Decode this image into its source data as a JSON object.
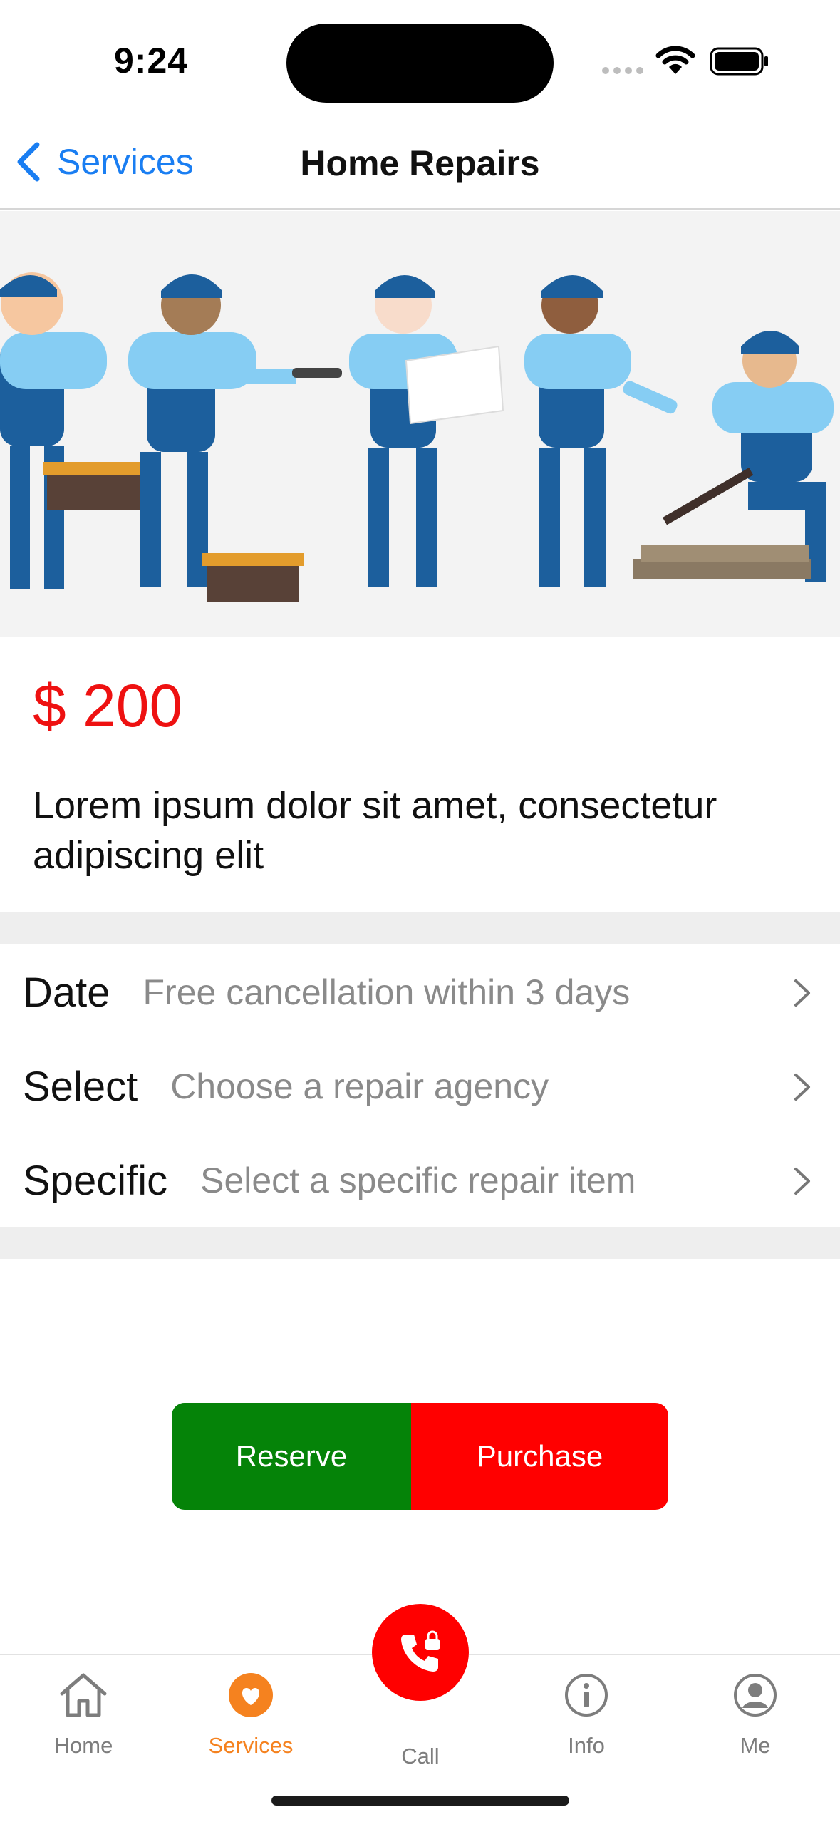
{
  "status_bar": {
    "time": "9:24"
  },
  "nav": {
    "back_label": "Services",
    "title": "Home Repairs"
  },
  "hero": {
    "image_alt": "illustration of repair workers"
  },
  "product": {
    "price": "$ 200",
    "description": "Lorem ipsum dolor sit amet, consectetur adipiscing elit"
  },
  "options": [
    {
      "label": "Date",
      "value": "Free cancellation within 3 days"
    },
    {
      "label": "Select",
      "value": "Choose a repair agency"
    },
    {
      "label": "Specific",
      "value": "Select a specific repair item"
    }
  ],
  "actions": {
    "reserve": "Reserve",
    "purchase": "Purchase"
  },
  "tabs": [
    {
      "label": "Home",
      "icon": "home-icon"
    },
    {
      "label": "Services",
      "icon": "heart-icon",
      "active": true
    },
    {
      "label": "Call",
      "icon": "phone-lock-icon"
    },
    {
      "label": "Info",
      "icon": "info-icon"
    },
    {
      "label": "Me",
      "icon": "person-icon"
    }
  ],
  "colors": {
    "accent_blue": "#1a7ef2",
    "price_red": "#ee1111",
    "reserve_green": "#058308",
    "purchase_red": "#ff0000",
    "tab_active": "#f5821f"
  }
}
